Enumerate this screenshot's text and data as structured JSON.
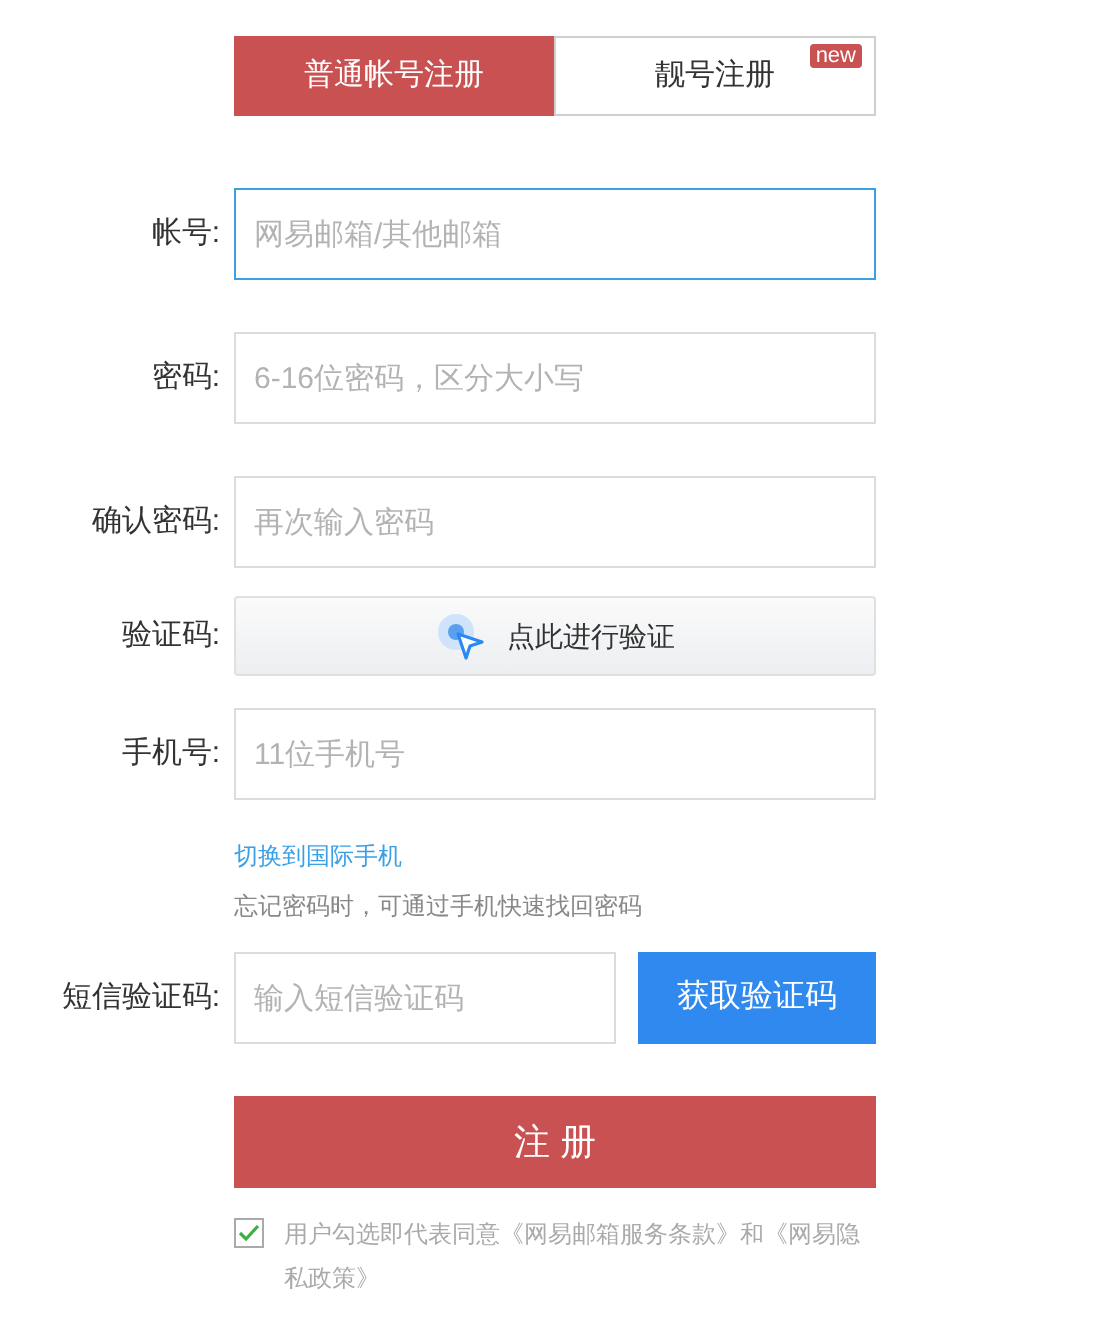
{
  "tabs": [
    {
      "label": "普通帐号注册",
      "selected": true
    },
    {
      "label": "靓号注册",
      "selected": false,
      "badge": "new"
    }
  ],
  "fields": [
    {
      "kind": "input",
      "label": "帐号:",
      "placeholder": "网易邮箱/其他邮箱",
      "focused": true
    },
    {
      "kind": "input",
      "label": "密码:",
      "placeholder": "6-16位密码，区分大小写",
      "focused": false
    },
    {
      "kind": "input",
      "label": "确认密码:",
      "placeholder": "再次输入密码",
      "focused": false
    },
    {
      "kind": "captcha",
      "label": "验证码:",
      "button": "点此进行验证"
    },
    {
      "kind": "input",
      "label": "手机号:",
      "placeholder": "11位手机号",
      "focused": false
    }
  ],
  "switch_link": "切换到国际手机",
  "hint": "忘记密码时，可通过手机快速找回密码",
  "sms": {
    "label": "短信验证码:",
    "placeholder": "输入短信验证码",
    "button": "获取验证码"
  },
  "register_button": "注 册",
  "agreement": {
    "checked": true,
    "text": "用户勾选即代表同意《网易邮箱服务条款》和《网易隐私政策》"
  }
}
